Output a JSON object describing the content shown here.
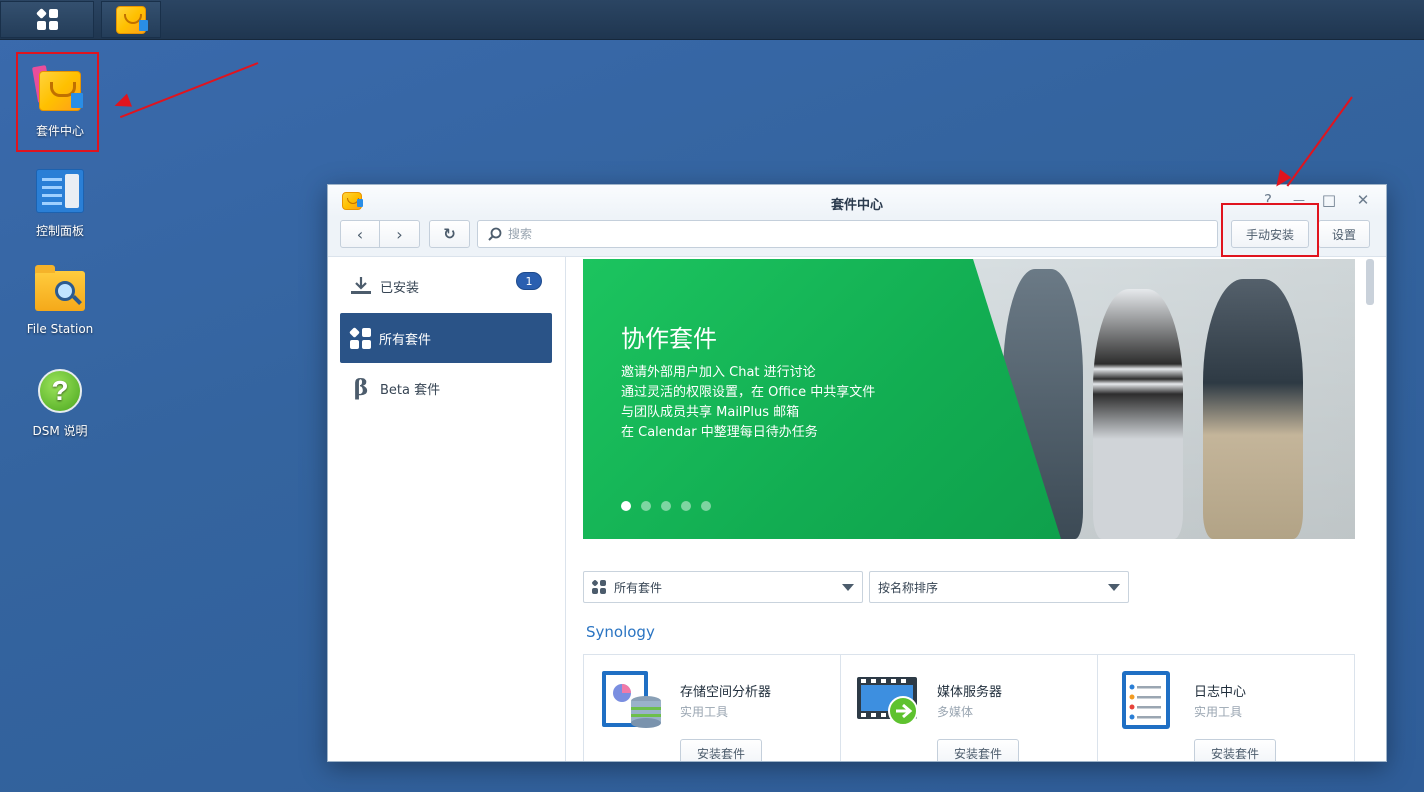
{
  "desktop": {
    "icons": [
      {
        "label": "套件中心",
        "icon": "package-center-icon"
      },
      {
        "label": "控制面板",
        "icon": "control-panel-icon"
      },
      {
        "label": "File Station",
        "icon": "file-station-icon"
      },
      {
        "label": "DSM 说明",
        "icon": "dsm-help-icon"
      }
    ]
  },
  "window": {
    "title": "套件中心",
    "toolbar": {
      "search_placeholder": "搜索",
      "manual_install_label": "手动安装",
      "settings_label": "设置",
      "help_glyph": "?",
      "minimize_glyph": "—",
      "maximize_glyph": "□",
      "close_glyph": "✕"
    },
    "sidebar": {
      "items": [
        {
          "label": "已安装",
          "badge": "1"
        },
        {
          "label": "所有套件"
        },
        {
          "label": "Beta 套件"
        }
      ],
      "active_index": 1
    },
    "banner": {
      "title": "协作套件",
      "lines": [
        "邀请外部用户加入 Chat 进行讨论",
        "通过灵活的权限设置，在 Office 中共享文件",
        "与团队成员共享 MailPlus 邮箱",
        "在 Calendar 中整理每日待办任务"
      ],
      "slide_count": 5,
      "active_slide": 0
    },
    "filters": {
      "category": "所有套件",
      "sort": "按名称排序"
    },
    "section_title": "Synology",
    "packages": [
      {
        "name": "存储空间分析器",
        "category": "实用工具",
        "button": "安装套件"
      },
      {
        "name": "媒体服务器",
        "category": "多媒体",
        "button": "安装套件"
      },
      {
        "name": "日志中心",
        "category": "实用工具",
        "button": "安装套件"
      }
    ]
  },
  "colors": {
    "desktop": "#34649f",
    "accent_active": "#2a5387",
    "banner_green": "#12ad52",
    "highlight_red": "#e0141e",
    "link_blue": "#2a74c2"
  }
}
